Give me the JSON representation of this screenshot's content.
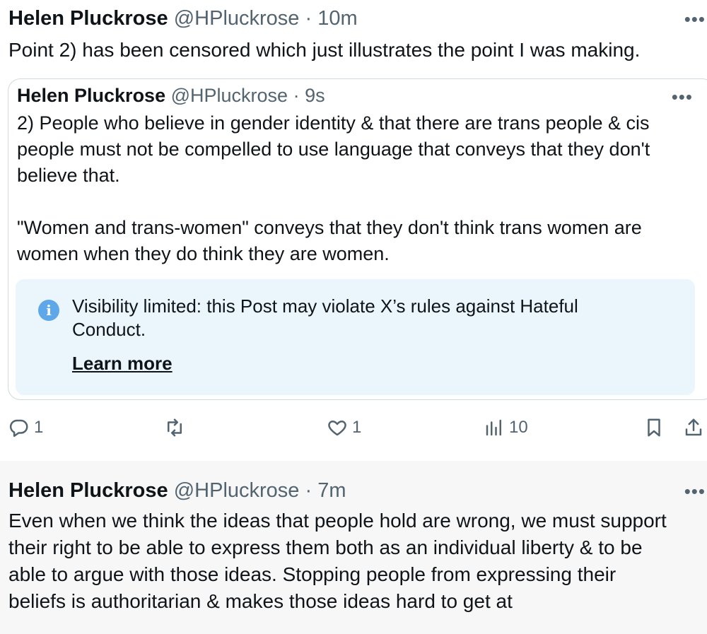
{
  "posts": [
    {
      "author": {
        "name": "Helen Pluckrose",
        "handle": "@HPluckrose",
        "separator": "·",
        "time": "10m"
      },
      "text": "Point 2) has been censored which just illustrates the point I was making.",
      "quote": {
        "author": {
          "name": "Helen Pluckrose",
          "handle": "@HPluckrose",
          "separator": "·",
          "time": "9s"
        },
        "text": "2) People who believe in gender identity & that there are trans people & cis\npeople must not be compelled to use language that conveys that they don't\nbelieve that.\n\n\"Women and trans-women\" conveys that they don't think trans women are\nwomen when they do think they are women.",
        "notice": {
          "icon": "info-icon",
          "icon_glyph": "i",
          "text": "Visibility limited: this Post may violate X’s rules against Hateful Conduct.",
          "link_label": "Learn more"
        }
      },
      "actions": {
        "replies": "1",
        "reposts": "",
        "likes": "1",
        "views": "10"
      }
    },
    {
      "author": {
        "name": "Helen Pluckrose",
        "handle": "@HPluckrose",
        "separator": "·",
        "time": "7m"
      },
      "text": "Even when we think the ideas that people hold are wrong, we must support\ntheir right to be able to express them both as an individual liberty & to be\nable to argue with those ideas. Stopping people from expressing their\nbeliefs is authoritarian & makes those ideas hard to get at"
    }
  ],
  "more_label": "•••",
  "colors": {
    "text": "#0f1419",
    "muted": "#536471",
    "notice_bg": "#ebf5fc",
    "info_blue": "#5ea7e8",
    "border": "#cfd9de"
  }
}
